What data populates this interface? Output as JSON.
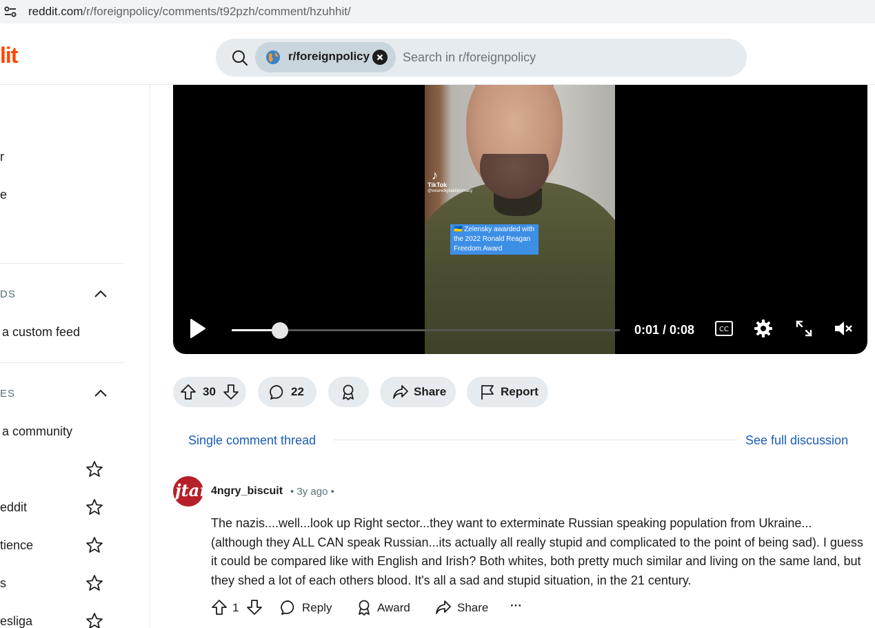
{
  "browser": {
    "url_host": "reddit.com",
    "url_path": "/r/foreignpolicy/comments/t92pzh/comment/hzuhhit/"
  },
  "header": {
    "logo_fragment": "lit",
    "search_chip": "r/foreignpolicy",
    "search_placeholder": "Search in r/foreignpolicy"
  },
  "sidebar": {
    "item1": "r",
    "item2": "e",
    "feeds_heading": "DS",
    "create_feed": "a custom feed",
    "communities_heading": "ES",
    "create_community": "a community",
    "communities": [
      "",
      "eddit",
      "tience",
      "s",
      "esliga"
    ]
  },
  "video": {
    "tiktok_name": "TikTok",
    "tiktok_handle": "@wearedigitaldiplomacy",
    "caption": "🇺🇦 Zelensky awarded with the 2022 Ronald Reagan Freedom Award",
    "time": "0:01 / 0:08",
    "progress_fraction": 0.125
  },
  "post_actions": {
    "votes": "30",
    "comments": "22",
    "share": "Share",
    "report": "Report"
  },
  "thread": {
    "single_label": "Single comment thread",
    "full_label": "See full discussion"
  },
  "comment": {
    "author": "4ngry_biscuit",
    "meta": "• 3y ago •",
    "avatar_text": "jtart",
    "text": "The nazis....well...look up Right sector...they want to exterminate Russian speaking population from Ukraine... (although they ALL CAN speak Russian...its actually all really stupid and complicated to the point of being sad). I guess it could be compared like with English and Irish? Both whites, both pretty much similar and living on the same land, but they shed a lot of each others blood. It's all a sad and stupid situation, in the 21 century.",
    "votes": "1",
    "reply": "Reply",
    "award": "Award",
    "share": "Share",
    "more": "···"
  }
}
